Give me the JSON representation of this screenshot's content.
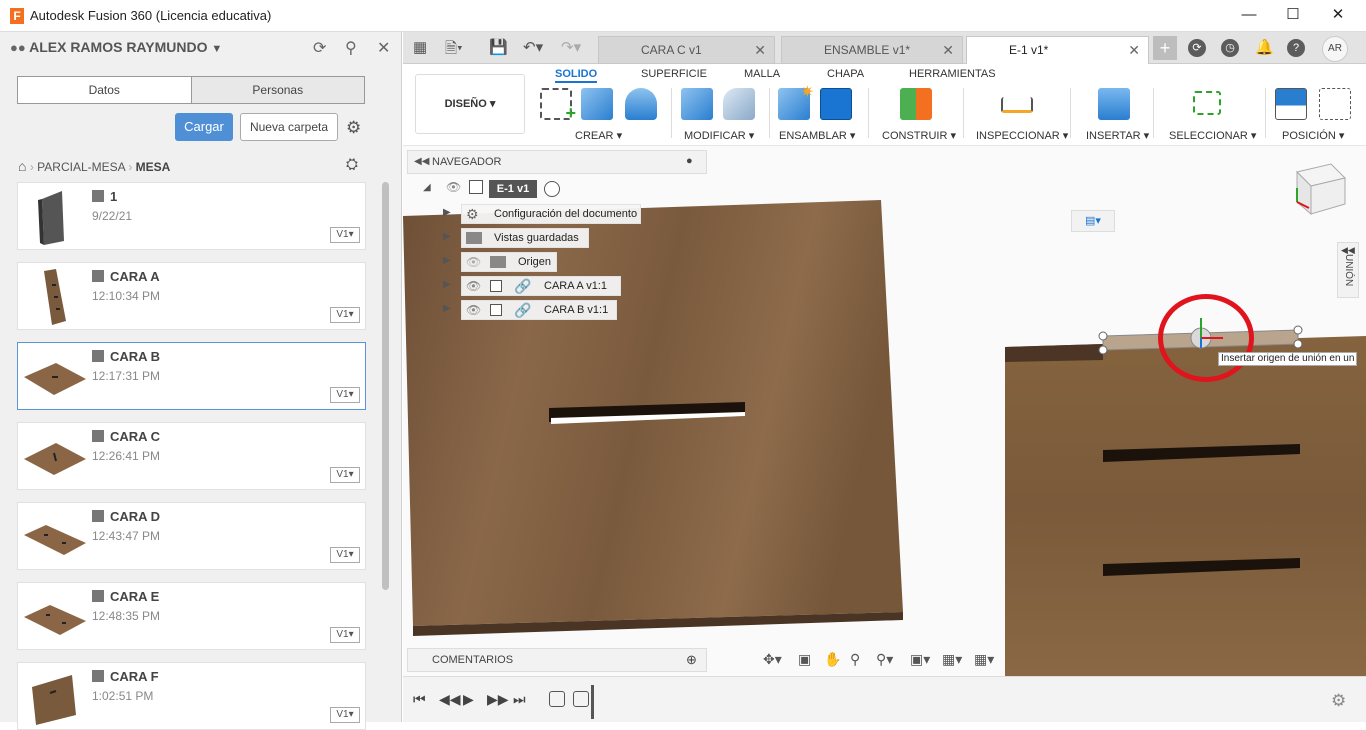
{
  "window": {
    "title": "Autodesk Fusion 360 (Licencia educativa)",
    "logo": "F"
  },
  "data_panel": {
    "user": "ALEX RAMOS RAYMUNDO",
    "tabs": [
      "Datos",
      "Personas"
    ],
    "upload_label": "Cargar",
    "new_folder_label": "Nueva carpeta",
    "breadcrumb": [
      "PARCIAL-MESA",
      "MESA"
    ],
    "items": [
      {
        "name": "1",
        "time": "9/22/21",
        "version": "V1",
        "selected": false
      },
      {
        "name": "CARA A",
        "time": "12:10:34 PM",
        "version": "V1",
        "selected": false
      },
      {
        "name": "CARA B",
        "time": "12:17:31 PM",
        "version": "V1",
        "selected": true
      },
      {
        "name": "CARA C",
        "time": "12:26:41 PM",
        "version": "V1",
        "selected": false
      },
      {
        "name": "CARA D",
        "time": "12:43:47 PM",
        "version": "V1",
        "selected": false
      },
      {
        "name": "CARA E",
        "time": "12:48:35 PM",
        "version": "V1",
        "selected": false
      },
      {
        "name": "CARA F",
        "time": "1:02:51 PM",
        "version": "V1",
        "selected": false
      }
    ]
  },
  "doc_tabs": [
    "CARA C v1",
    "ENSAMBLE v1*",
    "E-1 v1*"
  ],
  "avatar": "AR",
  "ribbon": {
    "workspace": "DISEÑO",
    "tabs": [
      "SOLIDO",
      "SUPERFICIE",
      "MALLA",
      "CHAPA",
      "HERRAMIENTAS"
    ],
    "groups": [
      "CREAR",
      "MODIFICAR",
      "ENSAMBLAR",
      "CONSTRUIR",
      "INSPECCIONAR",
      "INSERTAR",
      "SELECCIONAR",
      "POSICIÓN"
    ]
  },
  "browser": {
    "title": "NAVEGADOR",
    "root": "E-1 v1",
    "nodes": [
      "Configuración del documento",
      "Vistas guardadas",
      "Origen",
      "CARA A v1:1",
      "CARA B v1:1"
    ]
  },
  "comments_label": "COMENTARIOS",
  "union_label": "UNIÓN",
  "tooltip": "Insertar origen de unión en un",
  "colors": {
    "accent": "#1a74d1",
    "highlight": "#e0141c",
    "wood": "#7d5b3d"
  }
}
